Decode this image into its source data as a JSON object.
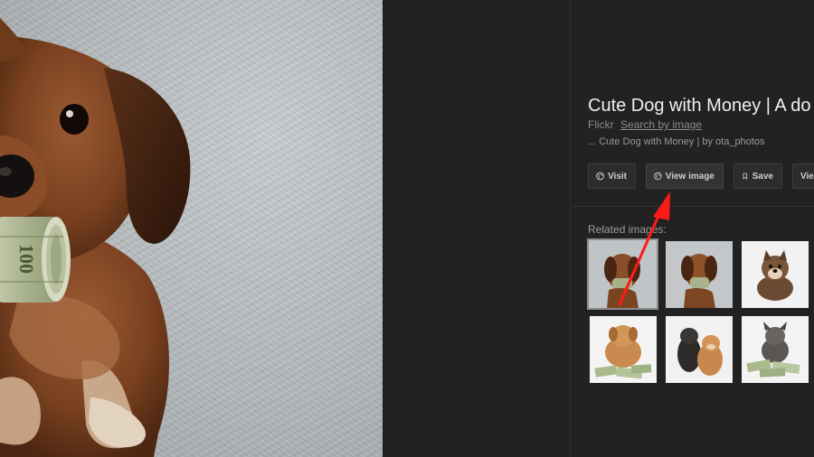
{
  "preview": {
    "alt_subject": "dog-with-money",
    "banknote_text": "100"
  },
  "details": {
    "title": "Cute Dog with Money | A do",
    "source": "Flickr",
    "search_by_image": "Search by image",
    "snippet": "... Cute Dog with Money | by ota_photos"
  },
  "actions": {
    "visit": "Visit",
    "view_image": "View image",
    "save": "Save",
    "more": "Vie"
  },
  "related": {
    "label": "Related images:",
    "items": [
      {
        "subject": "dachshund-with-money",
        "selected": true
      },
      {
        "subject": "dachshund-with-money"
      },
      {
        "subject": "shiba-puppy"
      },
      {
        "subject": "puppy-on-money"
      },
      {
        "subject": "two-puppies"
      },
      {
        "subject": "bulldog-on-money"
      }
    ]
  },
  "colors": {
    "background": "#222222",
    "annotation_arrow": "#ff1a1a",
    "button_bg": "#2c2c2c"
  }
}
